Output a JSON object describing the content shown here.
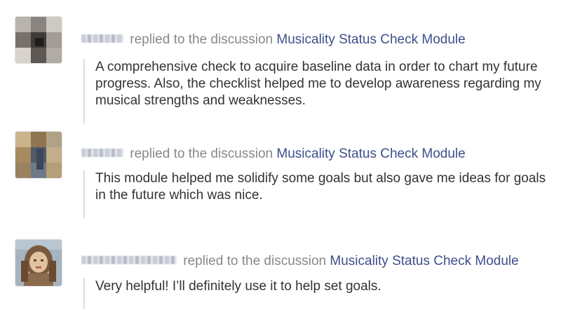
{
  "activity": [
    {
      "user_name": "",
      "action_text": "replied to the discussion",
      "discussion_title": "Musicality Status Check Module",
      "reply_text": "A comprehensive check to acquire baseline data in order to chart my future progress. Also, the checklist helped me to develop awareness regarding my musical strengths and weaknesses.",
      "avatar_colors": [
        "#8a8580",
        "#b9b3ad",
        "#5d5853",
        "#d8d2cc",
        "#3e3a36",
        "#a29c95"
      ]
    },
    {
      "user_name": "",
      "action_text": "replied to the discussion",
      "discussion_title": "Musicality Status Check Module",
      "reply_text": "This module helped me solidify some goals but also gave me ideas for goals in the future which was nice.",
      "avatar_colors": [
        "#a78a5e",
        "#6e7a8a",
        "#c9b48e",
        "#4f5a6b",
        "#8f7650",
        "#b0a286"
      ]
    },
    {
      "user_name": "",
      "action_text": "replied to the discussion",
      "discussion_title": "Musicality Status Check Module",
      "reply_text": "Very helpful! I’ll definitely use it to help set goals.",
      "avatar_colors": [
        "#7a5a3e",
        "#c89a72",
        "#e2c2a0",
        "#5b4a3a",
        "#a5b4c0",
        "#8c6a4c"
      ]
    }
  ],
  "colors": {
    "link": "#3d4f8a",
    "muted": "#888888",
    "body_text": "#333333",
    "quote_border": "#dcdcdc"
  }
}
